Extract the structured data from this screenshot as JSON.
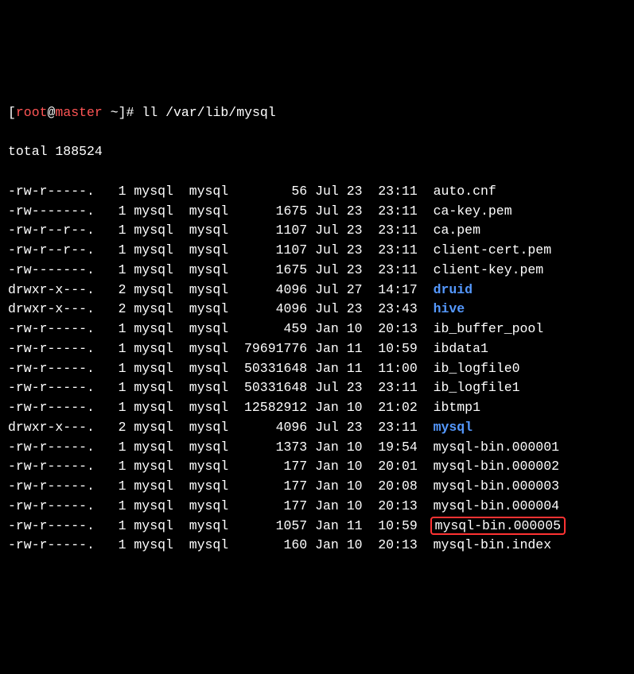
{
  "prompt": {
    "open_bracket": "[",
    "user": "root",
    "at": "@",
    "host": "master",
    "space": " ",
    "path": "~",
    "close_bracket": "]",
    "symbol": "#",
    "command": "ll /var/lib/mysql"
  },
  "total_line": "total 188524",
  "files": [
    {
      "perms": "-rw-r-----.",
      "links": "1",
      "user": "mysql",
      "group": "mysql",
      "size": "56",
      "month": "Jul",
      "day": "23",
      "time": "23:11",
      "name": "auto.cnf",
      "type": "file"
    },
    {
      "perms": "-rw-------.",
      "links": "1",
      "user": "mysql",
      "group": "mysql",
      "size": "1675",
      "month": "Jul",
      "day": "23",
      "time": "23:11",
      "name": "ca-key.pem",
      "type": "file"
    },
    {
      "perms": "-rw-r--r--.",
      "links": "1",
      "user": "mysql",
      "group": "mysql",
      "size": "1107",
      "month": "Jul",
      "day": "23",
      "time": "23:11",
      "name": "ca.pem",
      "type": "file"
    },
    {
      "perms": "-rw-r--r--.",
      "links": "1",
      "user": "mysql",
      "group": "mysql",
      "size": "1107",
      "month": "Jul",
      "day": "23",
      "time": "23:11",
      "name": "client-cert.pem",
      "type": "file"
    },
    {
      "perms": "-rw-------.",
      "links": "1",
      "user": "mysql",
      "group": "mysql",
      "size": "1675",
      "month": "Jul",
      "day": "23",
      "time": "23:11",
      "name": "client-key.pem",
      "type": "file"
    },
    {
      "perms": "drwxr-x---.",
      "links": "2",
      "user": "mysql",
      "group": "mysql",
      "size": "4096",
      "month": "Jul",
      "day": "27",
      "time": "14:17",
      "name": "druid",
      "type": "dir"
    },
    {
      "perms": "drwxr-x---.",
      "links": "2",
      "user": "mysql",
      "group": "mysql",
      "size": "4096",
      "month": "Jul",
      "day": "23",
      "time": "23:43",
      "name": "hive",
      "type": "dir"
    },
    {
      "perms": "-rw-r-----.",
      "links": "1",
      "user": "mysql",
      "group": "mysql",
      "size": "459",
      "month": "Jan",
      "day": "10",
      "time": "20:13",
      "name": "ib_buffer_pool",
      "type": "file"
    },
    {
      "perms": "-rw-r-----.",
      "links": "1",
      "user": "mysql",
      "group": "mysql",
      "size": "79691776",
      "month": "Jan",
      "day": "11",
      "time": "10:59",
      "name": "ibdata1",
      "type": "file"
    },
    {
      "perms": "-rw-r-----.",
      "links": "1",
      "user": "mysql",
      "group": "mysql",
      "size": "50331648",
      "month": "Jan",
      "day": "11",
      "time": "11:00",
      "name": "ib_logfile0",
      "type": "file"
    },
    {
      "perms": "-rw-r-----.",
      "links": "1",
      "user": "mysql",
      "group": "mysql",
      "size": "50331648",
      "month": "Jul",
      "day": "23",
      "time": "23:11",
      "name": "ib_logfile1",
      "type": "file"
    },
    {
      "perms": "-rw-r-----.",
      "links": "1",
      "user": "mysql",
      "group": "mysql",
      "size": "12582912",
      "month": "Jan",
      "day": "10",
      "time": "21:02",
      "name": "ibtmp1",
      "type": "file"
    },
    {
      "perms": "drwxr-x---.",
      "links": "2",
      "user": "mysql",
      "group": "mysql",
      "size": "4096",
      "month": "Jul",
      "day": "23",
      "time": "23:11",
      "name": "mysql",
      "type": "dir"
    },
    {
      "perms": "-rw-r-----.",
      "links": "1",
      "user": "mysql",
      "group": "mysql",
      "size": "1373",
      "month": "Jan",
      "day": "10",
      "time": "19:54",
      "name": "mysql-bin.000001",
      "type": "file"
    },
    {
      "perms": "-rw-r-----.",
      "links": "1",
      "user": "mysql",
      "group": "mysql",
      "size": "177",
      "month": "Jan",
      "day": "10",
      "time": "20:01",
      "name": "mysql-bin.000002",
      "type": "file"
    },
    {
      "perms": "-rw-r-----.",
      "links": "1",
      "user": "mysql",
      "group": "mysql",
      "size": "177",
      "month": "Jan",
      "day": "10",
      "time": "20:08",
      "name": "mysql-bin.000003",
      "type": "file"
    },
    {
      "perms": "-rw-r-----.",
      "links": "1",
      "user": "mysql",
      "group": "mysql",
      "size": "177",
      "month": "Jan",
      "day": "10",
      "time": "20:13",
      "name": "mysql-bin.000004",
      "type": "file"
    },
    {
      "perms": "-rw-r-----.",
      "links": "1",
      "user": "mysql",
      "group": "mysql",
      "size": "1057",
      "month": "Jan",
      "day": "11",
      "time": "10:59",
      "name": "mysql-bin.000005",
      "type": "file",
      "highlighted": true
    },
    {
      "perms": "-rw-r-----.",
      "links": "1",
      "user": "mysql",
      "group": "mysql",
      "size": "160",
      "month": "Jan",
      "day": "10",
      "time": "20:13",
      "name": "mysql-bin.index",
      "type": "file"
    }
  ]
}
